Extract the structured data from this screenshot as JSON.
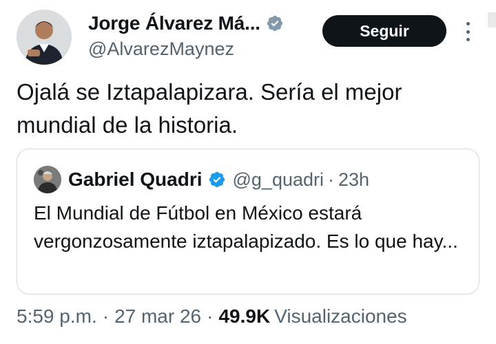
{
  "author": {
    "display_name": "Jorge Álvarez Má...",
    "handle": "@AlvarezMaynez",
    "verified_icon": "verified-badge-icon",
    "badge_color": "#829aab"
  },
  "follow_button": {
    "label": "Seguir"
  },
  "tweet": {
    "text": "Ojalá se Iztapalapizara. Sería el mejor mundial de la historia."
  },
  "quoted": {
    "display_name": "Gabriel Quadri",
    "handle": "@g_quadri",
    "separator": "·",
    "time": "23h",
    "badge_color": "#1d9bf0",
    "text": "El Mundial de Fútbol en México estará vergonzosamente iztapalapizado. Es lo que hay..."
  },
  "meta": {
    "time": "5:59 p.m.",
    "date": "27 mar 26",
    "separator": "·",
    "views_count": "49.9K",
    "views_label": "Visualizaciones"
  },
  "colors": {
    "text_primary": "#0f1419",
    "text_secondary": "#536471",
    "border": "#cfd9de",
    "button_bg": "#0f1419"
  }
}
